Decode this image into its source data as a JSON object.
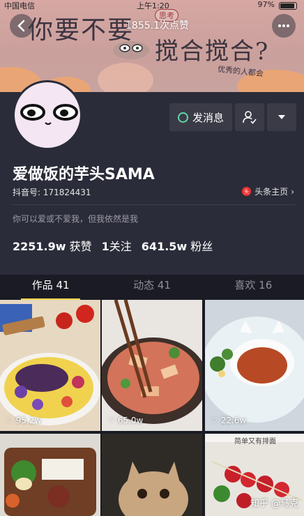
{
  "status_bar": {
    "carrier": "中国电信",
    "time": "上午1:20",
    "battery": "97%"
  },
  "banner": {
    "line1": "你要不要",
    "stamp": "思考",
    "line2": "搅合搅合?",
    "small": "优秀的人都会",
    "views": "1855.1次点赞"
  },
  "profile": {
    "name": "爱做饭的芋头SAMA",
    "douyin_id": "抖音号: 171824431",
    "toutiao_link": "头条主页",
    "bio": "你可以爱或不爱我，但我依然是我",
    "message_button": "发消息",
    "stats": {
      "likes_value": "2251.9w",
      "likes_label": "获赞",
      "following_value": "1",
      "following_label": "关注",
      "followers_value": "641.5w",
      "followers_label": "粉丝"
    }
  },
  "tabs": [
    {
      "label": "作品 41"
    },
    {
      "label": "动态 41"
    },
    {
      "label": "喜欢 16"
    }
  ],
  "grid": [
    {
      "likes": "95.2w"
    },
    {
      "likes": "65.0w"
    },
    {
      "likes": "22.6w"
    },
    {
      "likes": ""
    },
    {
      "likes": ""
    },
    {
      "likes": ""
    }
  ],
  "tile6_caption": "简单又有排面",
  "watermark": "知乎 @马克",
  "colors": {
    "accent": "#f6d34a",
    "profile_bg": "#2b2c39",
    "button_bg": "#3a3b47",
    "message_green": "#5fd9a7"
  }
}
